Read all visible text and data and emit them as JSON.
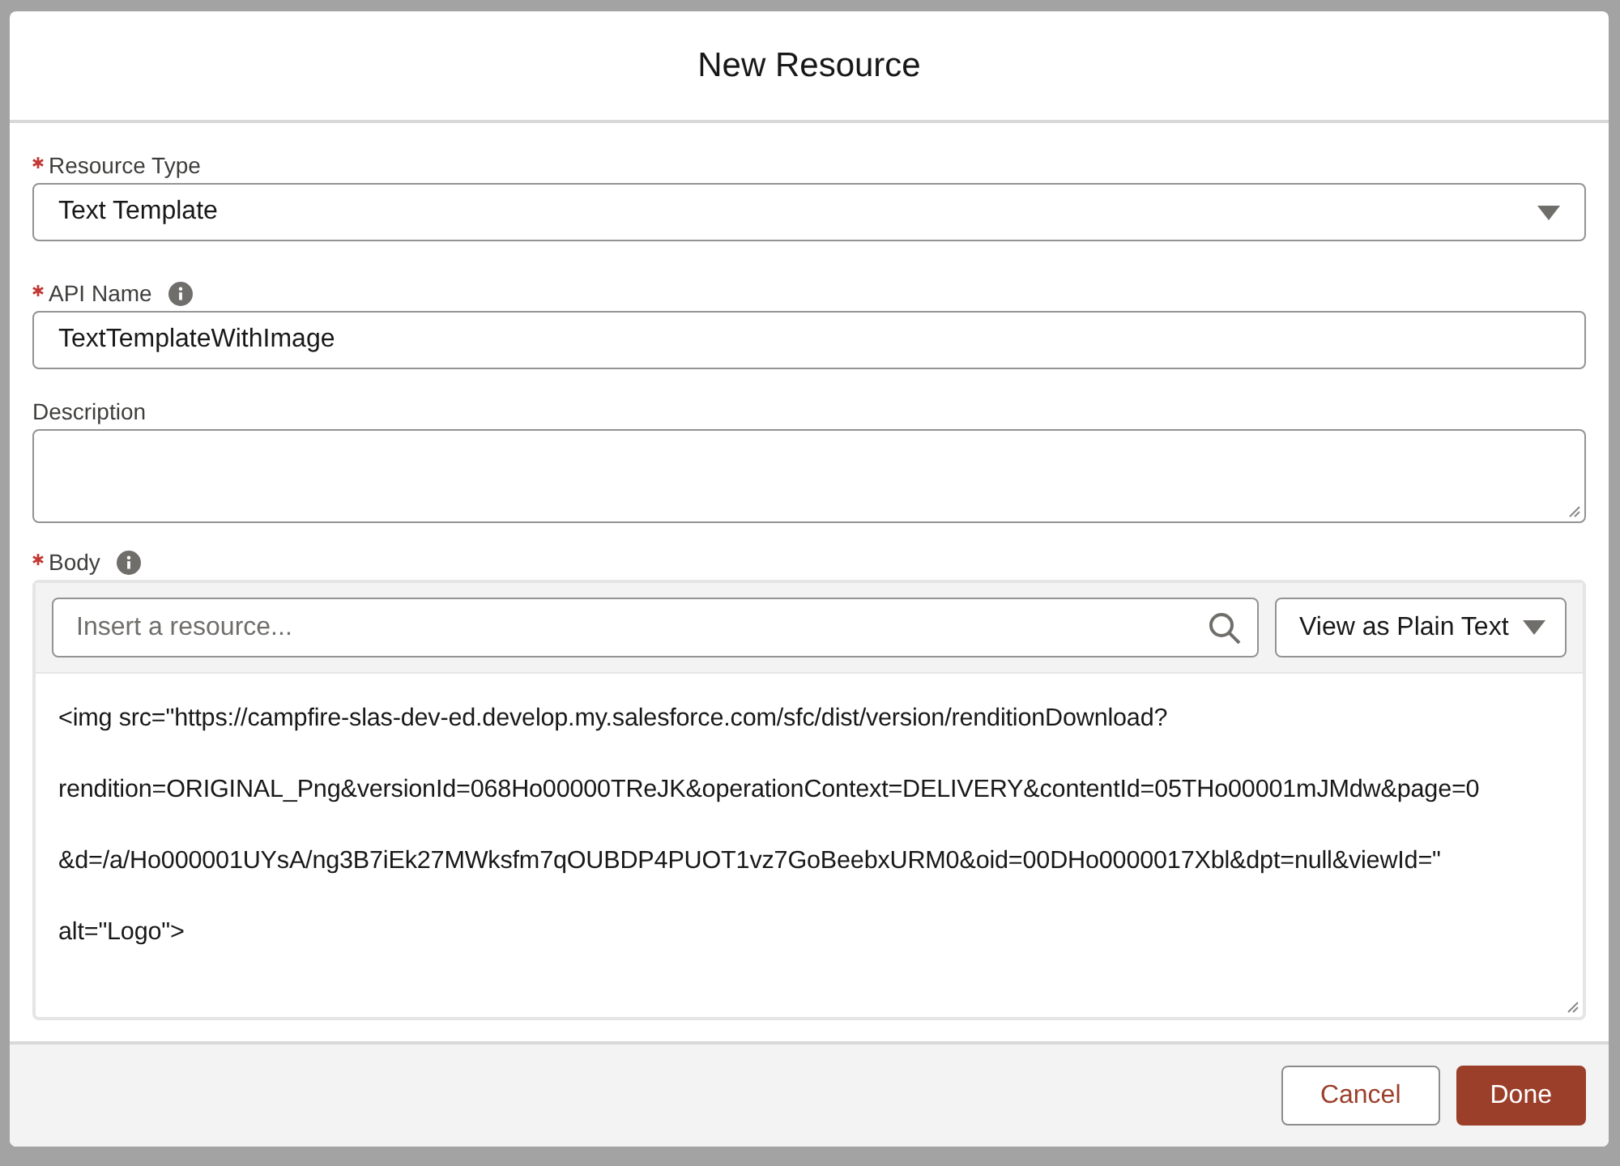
{
  "dialog": {
    "title": "New Resource"
  },
  "resource_type": {
    "label": "Resource Type",
    "required": true,
    "value": "Text Template"
  },
  "api_name": {
    "label": "API Name",
    "required": true,
    "value": "TextTemplateWithImage"
  },
  "description": {
    "label": "Description"
  },
  "body": {
    "label": "Body",
    "required": true,
    "search_placeholder": "Insert a resource...",
    "view_mode": "View as Plain Text",
    "lines": [
      "<img src=\"https://campfire-slas-dev-ed.develop.my.salesforce.com/sfc/dist/version/renditionDownload?",
      "rendition=ORIGINAL_Png&versionId=068Ho00000TReJK&operationContext=DELIVERY&contentId=05THo00001mJMdw&page=0",
      "&d=/a/Ho000001UYsA/ng3B7iEk27MWksfm7qOUBDP4PUOT1vz7GoBeebxURM0&oid=00DHo0000017Xbl&dpt=null&viewId=\"",
      "alt=\"Logo\">"
    ]
  },
  "buttons": [
    {
      "label": "Cancel",
      "kind": "neutral"
    },
    {
      "label": "Done",
      "kind": "brand"
    }
  ]
}
